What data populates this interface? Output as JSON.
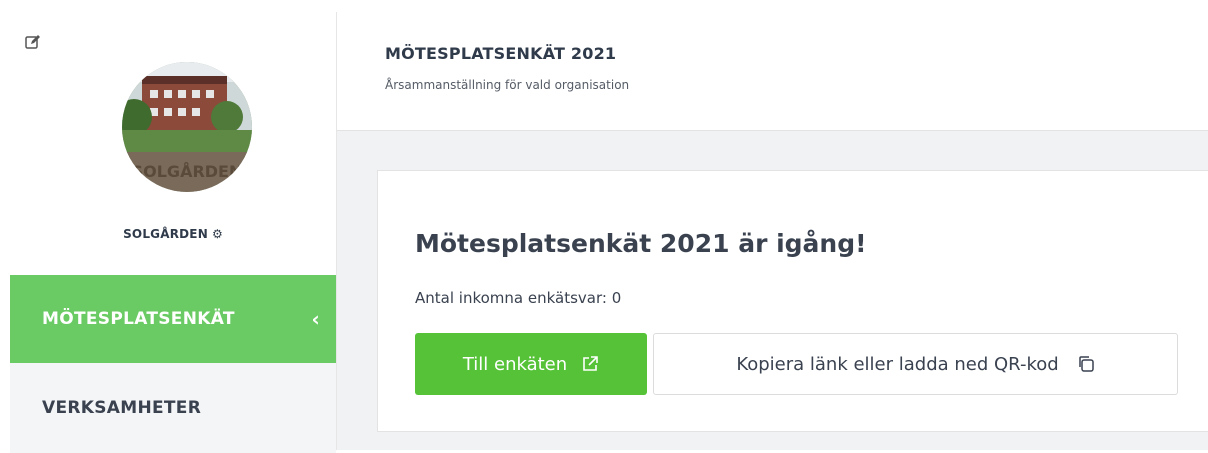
{
  "sidebar": {
    "org_name": "SOLGÅRDEN",
    "active_item": "MÖTESPLATSENKÄT",
    "items": [
      {
        "label": "VERKSAMHETER"
      }
    ]
  },
  "header": {
    "title": "MÖTESPLATSENKÄT 2021",
    "subtitle": "Årsammanställning för vald organisation"
  },
  "card": {
    "title": "Mötesplatsenkät 2021 är igång!",
    "count_text": "Antal inkomna enkätsvar: 0",
    "primary_button": "Till enkäten",
    "secondary_button": "Kopiera länk eller ladda ned QR-kod"
  },
  "colors": {
    "accent_green": "#6acb65",
    "button_green": "#55c237",
    "text_dark": "#3a4250"
  },
  "icons": [
    "edit-icon",
    "gear-icon",
    "chevron-left-icon",
    "external-link-icon",
    "copy-icon"
  ]
}
